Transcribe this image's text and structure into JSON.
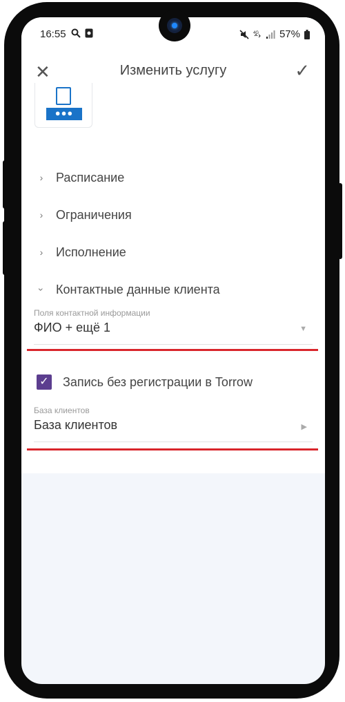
{
  "status_bar": {
    "time": "16:55",
    "battery": "57%"
  },
  "app_bar": {
    "title": "Изменить услугу"
  },
  "sections": [
    {
      "label": "Расписание",
      "expanded": false
    },
    {
      "label": "Ограничения",
      "expanded": false
    },
    {
      "label": "Исполнение",
      "expanded": false
    },
    {
      "label": "Контактные данные клиента",
      "expanded": true
    }
  ],
  "contact_fields": {
    "label": "Поля контактной информации",
    "value": "ФИО + ещё 1"
  },
  "no_registration": {
    "label": "Запись без регистрации в Torrow",
    "checked": true
  },
  "client_base": {
    "label": "База клиентов",
    "value": "База клиентов"
  },
  "colors": {
    "accent_purple": "#5c3e8f",
    "highlight_red": "#d9252b",
    "file_blue": "#1a73c8"
  },
  "icons": {
    "close": "close-icon",
    "confirm": "checkmark-icon",
    "file": "file-icon"
  }
}
